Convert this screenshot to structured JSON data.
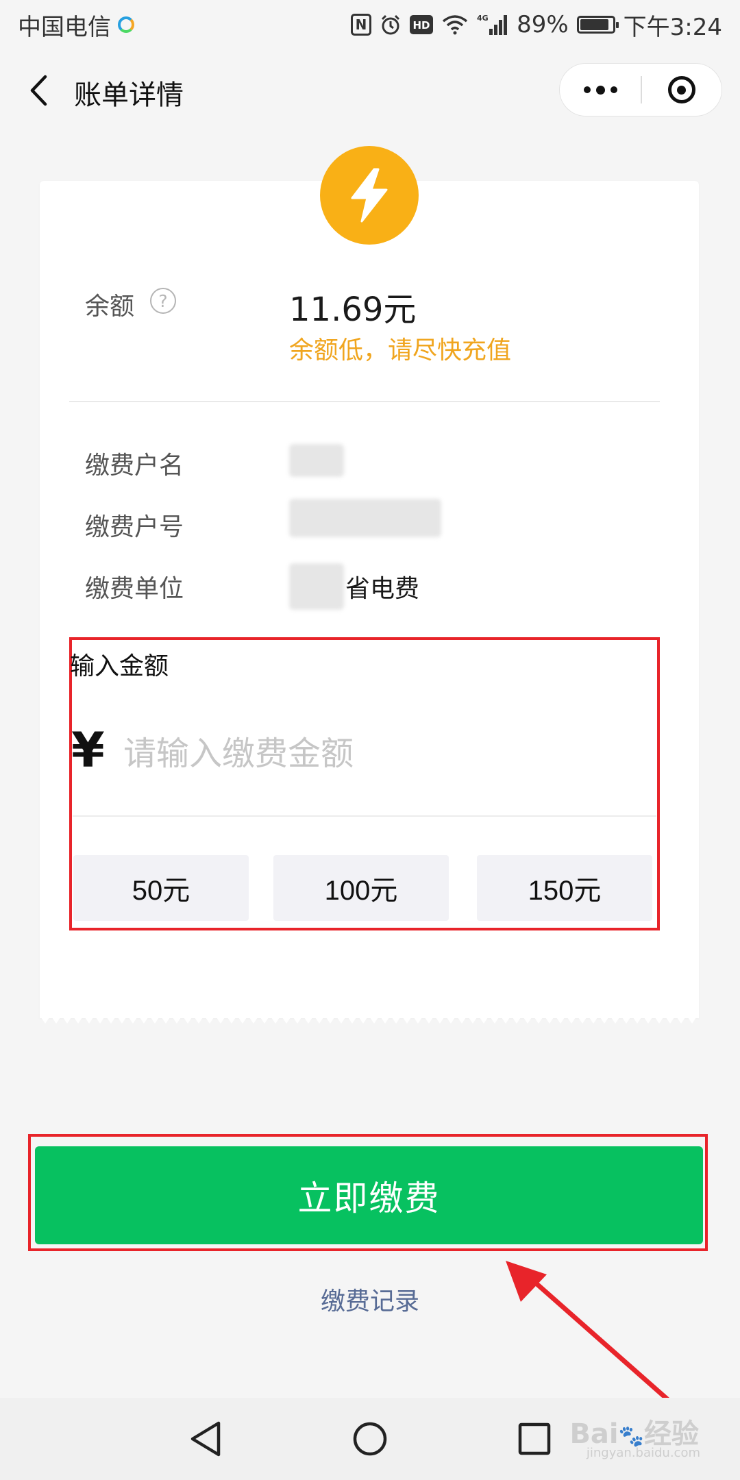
{
  "status_bar": {
    "carrier": "中国电信",
    "nfc": "N",
    "hd": "HD",
    "network": "4G",
    "battery": "89%",
    "battery_level": 0.89,
    "time": "下午3:24"
  },
  "nav": {
    "title": "账单详情"
  },
  "bill": {
    "balance_label": "余额",
    "balance_value": "11.69元",
    "balance_warning": "余额低，请尽快充值",
    "account_name_label": "缴费户名",
    "account_number_label": "缴费户号",
    "unit_label": "缴费单位",
    "unit_value_suffix": "省电费"
  },
  "amount": {
    "title": "输入金额",
    "currency": "¥",
    "placeholder": "请输入缴费金额",
    "quick_options": [
      "50元",
      "100元",
      "150元"
    ]
  },
  "actions": {
    "pay_now": "立即缴费",
    "history": "缴费记录"
  },
  "colors": {
    "accent_green": "#07c160",
    "warning_orange": "#f0a51e",
    "bolt_yellow": "#f9b016",
    "highlight_red": "#e8242a",
    "link_blue": "#576b95"
  },
  "watermark": {
    "brand": "Bai",
    "brand_suffix": "经验",
    "domain": "jingyan.baidu.com"
  }
}
